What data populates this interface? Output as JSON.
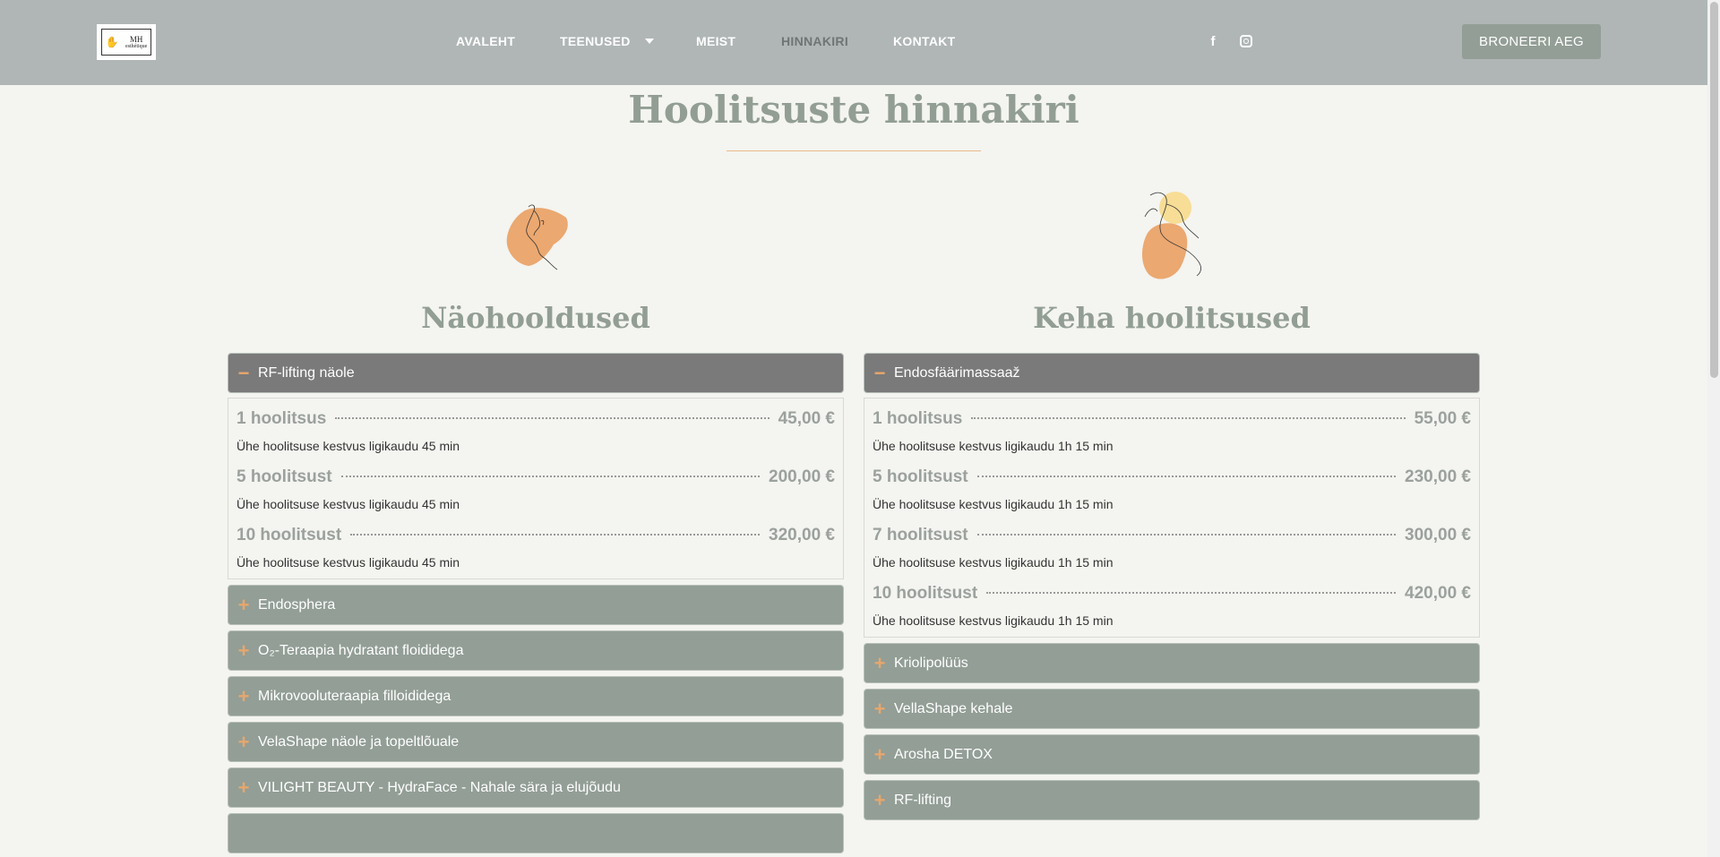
{
  "header": {
    "logo": {
      "line1": "MH",
      "line2": "esthétique"
    },
    "nav": [
      {
        "label": "AVALEHT"
      },
      {
        "label": "TEENUSED"
      },
      {
        "label": "MEIST"
      },
      {
        "label": "HINNAKIRI"
      },
      {
        "label": "KONTAKT"
      }
    ],
    "social": {
      "facebook": "f"
    },
    "book_label": "BRONEERI AEG"
  },
  "page": {
    "title": "Hoolitsuste hinnakiri"
  },
  "face": {
    "title": "Näohooldused",
    "open": {
      "label": "RF-lifting näole",
      "items": [
        {
          "name": "1 hoolitsus",
          "price": "45,00 €",
          "desc": "Ühe hoolitsuse kestvus ligikaudu 45 min"
        },
        {
          "name": "5 hoolitsust",
          "price": "200,00 €",
          "desc": "Ühe hoolitsuse kestvus ligikaudu 45 min"
        },
        {
          "name": "10 hoolitsust",
          "price": "320,00 €",
          "desc": "Ühe hoolitsuse kestvus ligikaudu 45 min"
        }
      ]
    },
    "closed": [
      {
        "label": "Endosphera"
      },
      {
        "label": "O₂-Teraapia hydratant floididega"
      },
      {
        "label": "Mikrovooluteraapia filloididega"
      },
      {
        "label": "VelaShape näole ja topeltlõuale"
      },
      {
        "label": "VILIGHT BEAUTY - HydraFace - Nahale sära ja elujõudu"
      }
    ]
  },
  "body": {
    "title": "Keha hoolitsused",
    "open": {
      "label": "Endosfäärimassaaž",
      "items": [
        {
          "name": "1 hoolitsus",
          "price": "55,00 €",
          "desc": "Ühe hoolitsuse kestvus ligikaudu 1h 15 min"
        },
        {
          "name": "5 hoolitsust",
          "price": "230,00 €",
          "desc": "Ühe hoolitsuse kestvus ligikaudu 1h 15 min"
        },
        {
          "name": "7 hoolitsust",
          "price": "300,00 €",
          "desc": "Ühe hoolitsuse kestvus ligikaudu 1h 15 min"
        },
        {
          "name": "10 hoolitsust",
          "price": "420,00 €",
          "desc": "Ühe hoolitsuse kestvus ligikaudu 1h 15 min"
        }
      ]
    },
    "closed": [
      {
        "label": "Kriolipolüüs"
      },
      {
        "label": "VellaShape kehale"
      },
      {
        "label": "Arosha DETOX"
      },
      {
        "label": "RF-lifting"
      }
    ]
  },
  "icons": {
    "open": "minus-icon",
    "closed": "plus-icon"
  },
  "colors": {
    "header_bg": "#b0b6b6",
    "accent": "#e8a66c",
    "sage": "#929e96",
    "open_header": "#7a7a7a",
    "page_bg": "#f4f4f0"
  }
}
